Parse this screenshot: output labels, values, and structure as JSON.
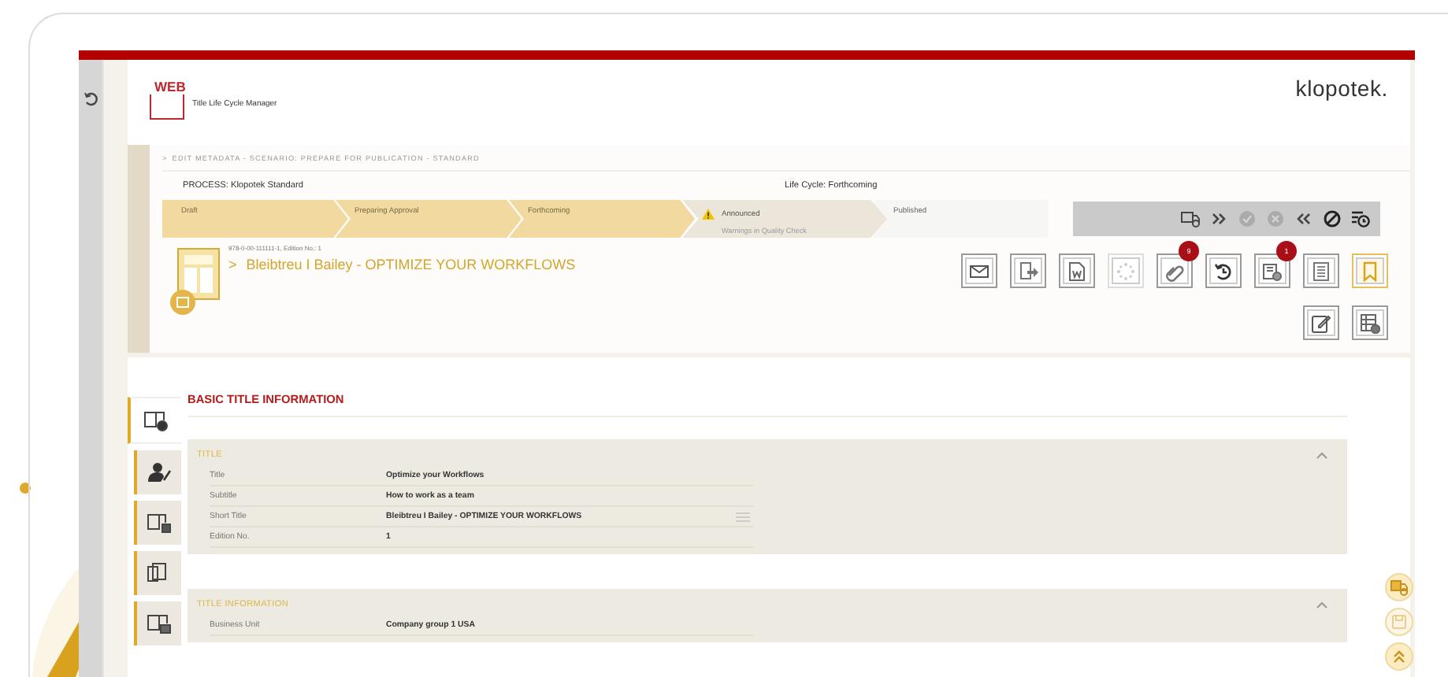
{
  "app": {
    "logo_word": "WEB",
    "product_name": "Title Life Cycle Manager",
    "brand": "klopotek."
  },
  "breadcrumb": {
    "separator": ">",
    "text": "EDIT METADATA - SCENARIO: PREPARE FOR PUBLICATION - STANDARD"
  },
  "process": "PROCESS: Klopotek Standard",
  "life_cycle": "Life Cycle: Forthcoming",
  "steps": [
    {
      "label": "Draft",
      "done": true,
      "selected": false,
      "warning": false
    },
    {
      "label": "Preparing Approval",
      "done": true,
      "selected": false,
      "warning": false
    },
    {
      "label": "Forthcoming",
      "done": true,
      "selected": false,
      "warning": false
    },
    {
      "label": "Announced",
      "sublabel": "Warnings in Quality Check",
      "done": false,
      "selected": true,
      "warning": true
    },
    {
      "label": "Published",
      "done": false,
      "selected": false,
      "warning": false
    }
  ],
  "workflow_actions": [
    {
      "kind": "truck",
      "disabled": false
    },
    {
      "kind": "forward",
      "disabled": false
    },
    {
      "kind": "approve",
      "disabled": true
    },
    {
      "kind": "reject",
      "disabled": true
    },
    {
      "kind": "back",
      "disabled": false
    },
    {
      "kind": "cancel",
      "disabled": false
    },
    {
      "kind": "schedule",
      "disabled": false
    }
  ],
  "title_record": {
    "identifier": "978-0-00-111111-1, Edition No.: 1",
    "chevron": ">",
    "name": "Bleibtreu I Bailey - OPTIMIZE YOUR WORKFLOWS"
  },
  "toolbar": [
    {
      "kind": "mail",
      "disabled": false,
      "highlighted": false
    },
    {
      "kind": "export",
      "disabled": false,
      "highlighted": false
    },
    {
      "kind": "word",
      "disabled": false,
      "highlighted": false
    },
    {
      "kind": "spinner",
      "disabled": true,
      "highlighted": false
    },
    {
      "kind": "attachment",
      "disabled": false,
      "highlighted": false,
      "badge": "9"
    },
    {
      "kind": "history",
      "disabled": false,
      "highlighted": false
    },
    {
      "kind": "document",
      "disabled": false,
      "highlighted": false,
      "badge": "1"
    },
    {
      "kind": "notes",
      "disabled": false,
      "highlighted": false
    },
    {
      "kind": "bookmark",
      "disabled": false,
      "highlighted": true
    },
    {
      "kind": "edit",
      "disabled": false,
      "highlighted": false
    },
    {
      "kind": "table",
      "disabled": false,
      "highlighted": false
    }
  ],
  "section_title": "BASIC TITLE INFORMATION",
  "side_tabs": [
    {
      "kind": "info",
      "selected": true
    },
    {
      "kind": "person",
      "selected": false
    },
    {
      "kind": "media",
      "selected": false
    },
    {
      "kind": "copies",
      "selected": false
    },
    {
      "kind": "calendar",
      "selected": false
    }
  ],
  "panels": [
    {
      "title": "TITLE",
      "expanded": true,
      "rows": [
        {
          "label": "Title",
          "value": "Optimize your Workflows",
          "has_menu": false
        },
        {
          "label": "Subtitle",
          "value": "How to work as a team",
          "has_menu": false
        },
        {
          "label": "Short Title",
          "value": "Bleibtreu I Bailey - OPTIMIZE YOUR WORKFLOWS",
          "has_menu": true
        },
        {
          "label": "Edition No.",
          "value": "1",
          "has_menu": false
        }
      ]
    },
    {
      "title": "TITLE INFORMATION",
      "expanded": true,
      "rows": [
        {
          "label": "Business Unit",
          "value": "Company group 1 USA",
          "has_menu": false
        }
      ]
    }
  ],
  "floating_buttons": [
    {
      "kind": "truck",
      "disabled": false
    },
    {
      "kind": "save",
      "disabled": true
    },
    {
      "kind": "scroll-up",
      "disabled": false
    }
  ]
}
